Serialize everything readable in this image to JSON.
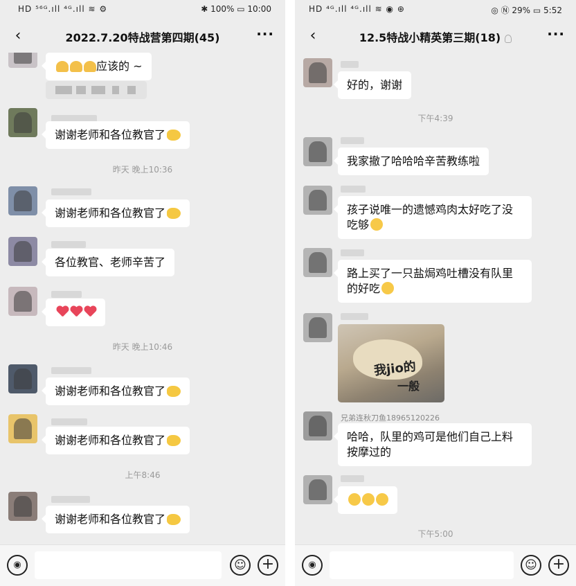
{
  "left": {
    "status": {
      "left": "HD ⁵⁶ᴳ.ıll ⁴ᴳ.ıll ≋ ⚙",
      "right": "✱ 100% ▭ 10:00"
    },
    "title": "2022.7.20特战营第四期(45)",
    "back_label": "‹",
    "more_label": "···",
    "messages": [
      {
        "text": "应该的 ~"
      },
      {
        "text": "谢谢老师和各位教官了"
      },
      {
        "time": "昨天 晚上10:36"
      },
      {
        "text": "谢谢老师和各位教官了"
      },
      {
        "text": "各位教官、老师辛苦了"
      },
      {
        "text": ""
      },
      {
        "time": "昨天 晚上10:46"
      },
      {
        "text": "谢谢老师和各位教官了"
      },
      {
        "text": "谢谢老师和各位教官了"
      },
      {
        "time": "上午8:46"
      },
      {
        "text": "谢谢老师和各位教官了"
      }
    ]
  },
  "right": {
    "status": {
      "left": "HD ⁴ᴳ.ıll ⁴ᴳ.ıll ≋ ◉ ⊕",
      "right": "◎ Ⓝ 29% ▭ 5:52"
    },
    "title": "12.5特战小精英第三期(18)",
    "back_label": "‹",
    "more_label": "···",
    "messages": [
      {
        "text": "好的，谢谢"
      },
      {
        "time": "下午4:39"
      },
      {
        "text": "我家撤了哈哈哈辛苦教练啦"
      },
      {
        "text": "孩子说唯一的遗憾鸡肉太好吃了没吃够"
      },
      {
        "text": "路上买了一只盐焗鸡吐槽没有队里的好吃"
      },
      {
        "image_caption_1": "我jio的",
        "image_caption_2": "一般"
      },
      {
        "sender": "兄弟连秋刀鱼18965120226",
        "text": "哈哈，队里的鸡可是他们自己上料按摩过的"
      },
      {
        "text": ""
      },
      {
        "time": "下午5:00"
      }
    ]
  },
  "inputbar": {
    "voice_icon": "◉",
    "emoji_icon": "☺",
    "plus_icon": "+"
  }
}
